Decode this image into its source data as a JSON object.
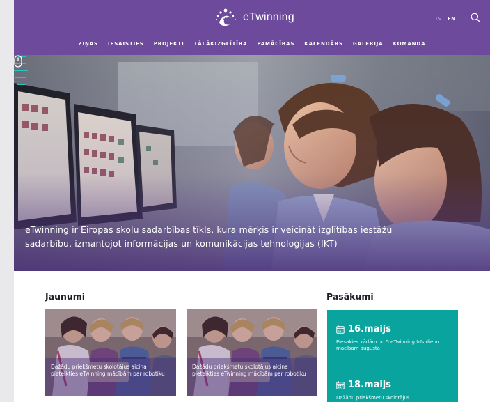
{
  "header": {
    "logo_text": "eTwinning",
    "lang_lv": "LV",
    "lang_en": "EN",
    "nav": [
      "ZIŅAS",
      "IESAISTIES",
      "PROJEKTI",
      "TĀLĀKIZGLĪTĪBA",
      "PAMĀCĪBAS",
      "KALENDĀRS",
      "GALERIJA",
      "KOMANDA"
    ]
  },
  "hero": {
    "text": "eTwinning ir Eiropas skolu sadarbības tīkls, kura mērķis ir veicināt izglītības iestāžu sadarbību, izmantojot informācijas un komunikācijas tehnoloģijas (IKT)"
  },
  "news": {
    "title": "Jaunumi",
    "cards": [
      {
        "caption": "Dažādu priekšmetu skolotājus aicina pieteikties eTwinning mācībām par robotiku"
      },
      {
        "caption": "Dažādu priekšmetu skolotājus aicina pieteikties eTwinning mācībām par robotiku"
      }
    ]
  },
  "events": {
    "title": "Pasākumi",
    "items": [
      {
        "date": "16.maijs",
        "desc": "Piesakies kādām no 5 eTwinning trīs dienu mācībām augustā"
      },
      {
        "date": "18.maijs",
        "desc": "Dažādu priekšmetu skolotājus"
      }
    ]
  },
  "colors": {
    "header_purple": "#6d4a9b",
    "events_teal": "#0aa49f",
    "accent_teal": "#27c3c0"
  },
  "icons": [
    "etwinning-logo-icon",
    "search-icon",
    "hamburger-menu-icon",
    "scroll-mouse-icon",
    "calendar-icon"
  ]
}
